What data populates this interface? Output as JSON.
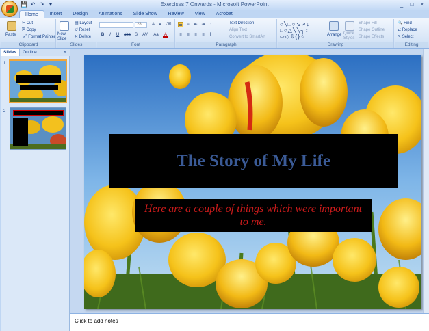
{
  "window": {
    "title": "Exercises 7 Onwards - Microsoft PowerPoint",
    "controls": [
      "_",
      "□",
      "×"
    ]
  },
  "quick_access": [
    "💾",
    "↶",
    "↷",
    "▾"
  ],
  "tabs": [
    "Home",
    "Insert",
    "Design",
    "Animations",
    "Slide Show",
    "Review",
    "View",
    "Acrobat"
  ],
  "active_tab": "Home",
  "ribbon": {
    "clipboard": {
      "paste": "Paste",
      "cut": "Cut",
      "copy": "Copy",
      "format_painter": "Format Painter",
      "label": "Clipboard"
    },
    "slides": {
      "new_slide": "New Slide",
      "layout": "Layout",
      "reset": "Reset",
      "delete": "Delete",
      "label": "Slides"
    },
    "font": {
      "size": "28",
      "label": "Font",
      "buttons": [
        "B",
        "I",
        "U",
        "abc",
        "S",
        "AV",
        "Aa",
        "A"
      ]
    },
    "paragraph": {
      "text_direction": "Text Direction",
      "align_text": "Align Text",
      "convert_smartart": "Convert to SmartArt",
      "label": "Paragraph"
    },
    "drawing": {
      "arrange": "Arrange",
      "quick_styles": "Quick Styles",
      "shape_fill": "Shape Fill",
      "shape_outline": "Shape Outline",
      "shape_effects": "Shape Effects",
      "label": "Drawing"
    },
    "editing": {
      "find": "Find",
      "replace": "Replace",
      "select": "Select",
      "label": "Editing"
    }
  },
  "left_pane": {
    "tabs": [
      "Slides",
      "Outline"
    ],
    "close": "×",
    "slide_numbers": [
      "1",
      "2"
    ]
  },
  "slide": {
    "title": "The Story of My Life",
    "subtitle": "Here are a couple of things which were important to me."
  },
  "notes_placeholder": "Click to add notes"
}
